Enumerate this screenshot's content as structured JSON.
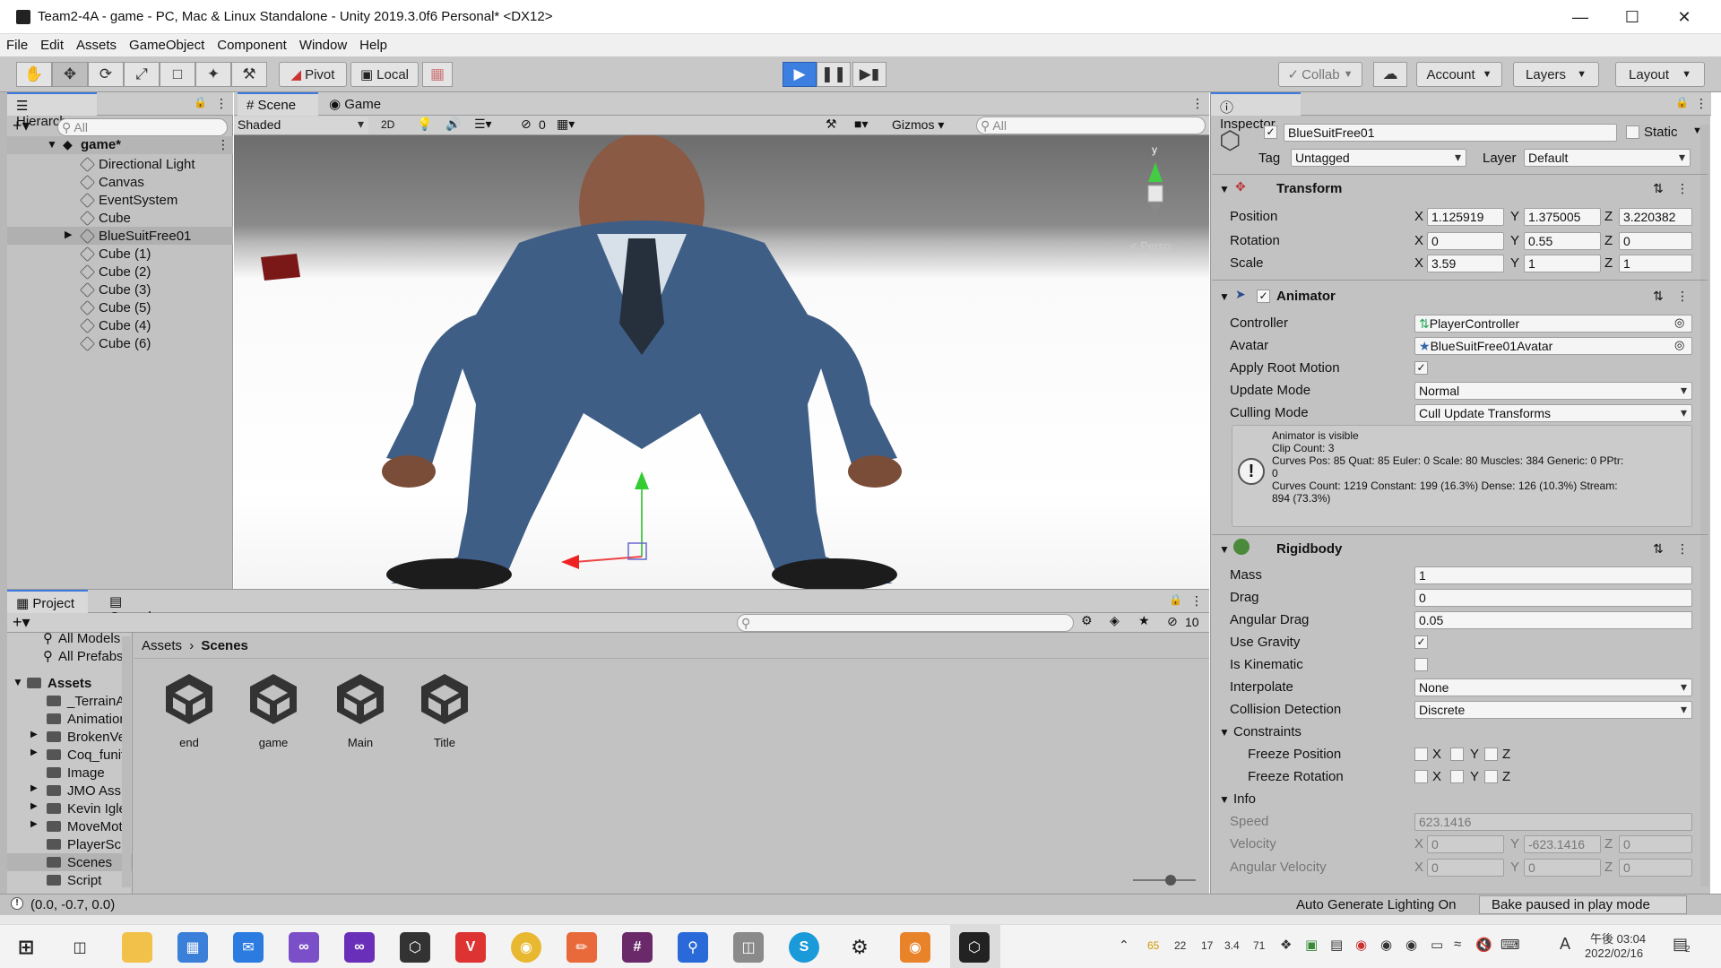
{
  "window": {
    "title": "Team2-4A - game - PC, Mac & Linux Standalone - Unity 2019.3.0f6 Personal* <DX12>"
  },
  "menu": [
    "File",
    "Edit",
    "Assets",
    "GameObject",
    "Component",
    "Window",
    "Help"
  ],
  "toolbar": {
    "pivot": "Pivot",
    "local": "Local",
    "collab": "Collab",
    "account": "Account",
    "layers": "Layers",
    "layout": "Layout"
  },
  "hierarchy": {
    "title": "Hierarchy",
    "search_placeholder": "All",
    "scene": "game*",
    "items": [
      "Directional Light",
      "Canvas",
      "EventSystem",
      "Cube",
      "BlueSuitFree01",
      "Cube (1)",
      "Cube (2)",
      "Cube (3)",
      "Cube (5)",
      "Cube (4)",
      "Cube (6)"
    ]
  },
  "scene_view": {
    "tab_scene": "Scene",
    "tab_game": "Game",
    "shading": "Shaded",
    "mode_2d": "2D",
    "hidden_count": "0",
    "gizmos": "Gizmos",
    "search_placeholder": "All",
    "axis_y": "y",
    "persp": "< Persp"
  },
  "project": {
    "tab_project": "Project",
    "tab_console": "Console",
    "fav_items": [
      "All Models",
      "All Prefabs"
    ],
    "root": "Assets",
    "folders": [
      "_TerrainA",
      "Animation",
      "BrokenVe",
      "Coq_funit",
      "Image",
      "JMO Ass",
      "Kevin Igle",
      "MoveMot",
      "PlayerSc",
      "Scenes",
      "Script"
    ],
    "breadcrumb": [
      "Assets",
      "Scenes"
    ],
    "assets": [
      "end",
      "game",
      "Main",
      "Title"
    ],
    "hidden_count": "10"
  },
  "inspector": {
    "title": "Inspector",
    "object_name": "BlueSuitFree01",
    "static_label": "Static",
    "tag_label": "Tag",
    "tag_value": "Untagged",
    "layer_label": "Layer",
    "layer_value": "Default",
    "transform": {
      "title": "Transform",
      "position_label": "Position",
      "position": [
        "1.125919",
        "1.375005",
        "3.220382"
      ],
      "rotation_label": "Rotation",
      "rotation": [
        "0",
        "0.55",
        "0"
      ],
      "scale_label": "Scale",
      "scale": [
        "3.59",
        "1",
        "1"
      ]
    },
    "animator": {
      "title": "Animator",
      "controller_label": "Controller",
      "controller": "PlayerController",
      "avatar_label": "Avatar",
      "avatar": "BlueSuitFree01Avatar",
      "root_motion_label": "Apply Root Motion",
      "update_mode_label": "Update Mode",
      "update_mode": "Normal",
      "culling_mode_label": "Culling Mode",
      "culling_mode": "Cull Update Transforms",
      "info_lines": [
        "Animator is visible",
        "Clip Count: 3",
        "Curves Pos: 85 Quat: 85 Euler: 0 Scale: 80 Muscles: 384 Generic: 0 PPtr:",
        "0",
        "Curves Count: 1219 Constant: 199 (16.3%) Dense: 126 (10.3%) Stream:",
        "894 (73.3%)"
      ]
    },
    "rigidbody": {
      "title": "Rigidbody",
      "mass_label": "Mass",
      "mass": "1",
      "drag_label": "Drag",
      "drag": "0",
      "angular_drag_label": "Angular Drag",
      "angular_drag": "0.05",
      "use_gravity_label": "Use Gravity",
      "is_kinematic_label": "Is Kinematic",
      "interpolate_label": "Interpolate",
      "interpolate": "None",
      "collision_label": "Collision Detection",
      "collision": "Discrete",
      "constraints_label": "Constraints",
      "freeze_pos_label": "Freeze Position",
      "freeze_rot_label": "Freeze Rotation",
      "info_label": "Info",
      "speed_label": "Speed",
      "speed": "623.1416",
      "velocity_label": "Velocity",
      "velocity": [
        "0",
        "-623.1416",
        "0"
      ],
      "ang_velocity_label": "Angular Velocity",
      "ang_velocity": [
        "0",
        "0",
        "0"
      ],
      "axis": [
        "X",
        "Y",
        "Z"
      ]
    }
  },
  "statusbar": {
    "coords": "(0.0, -0.7, 0.0)",
    "auto_lighting": "Auto Generate Lighting On",
    "bake": "Bake paused in play mode"
  },
  "taskbar": {
    "tray_nums": [
      "65",
      "22",
      "17",
      "3.4",
      "71"
    ],
    "time": "午後 03:04",
    "date": "2022/02/16",
    "notif": "2"
  }
}
